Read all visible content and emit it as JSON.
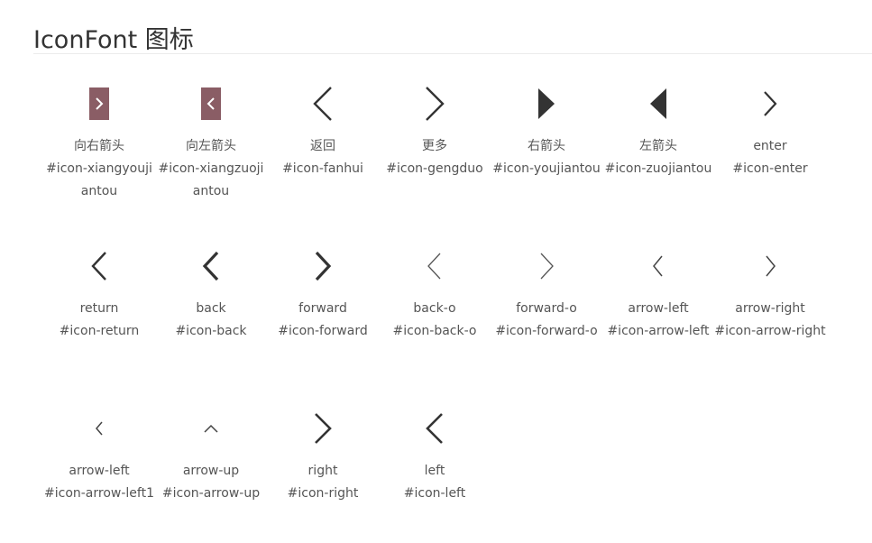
{
  "page": {
    "title": "IconFont 图标"
  },
  "icons": [
    {
      "label": "向右箭头",
      "code": "#icon-xiangyoujiantou",
      "icon": "arrow-right-boxed-icon",
      "color": "#8a5d65"
    },
    {
      "label": "向左箭头",
      "code": "#icon-xiangzuojiantou",
      "icon": "arrow-left-boxed-icon",
      "color": "#8a5d65"
    },
    {
      "label": "返回",
      "code": "#icon-fanhui",
      "icon": "chevron-left-large-icon"
    },
    {
      "label": "更多",
      "code": "#icon-gengduo",
      "icon": "chevron-right-large-icon"
    },
    {
      "label": "右箭头",
      "code": "#icon-youjiantou",
      "icon": "triangle-right-icon"
    },
    {
      "label": "左箭头",
      "code": "#icon-zuojiantou",
      "icon": "triangle-left-icon"
    },
    {
      "label": "enter",
      "code": "#icon-enter",
      "icon": "chevron-right-icon"
    },
    {
      "label": "return",
      "code": "#icon-return",
      "icon": "chevron-left-icon"
    },
    {
      "label": "back",
      "code": "#icon-back",
      "icon": "chevron-left-bold-icon"
    },
    {
      "label": "forward",
      "code": "#icon-forward",
      "icon": "chevron-right-bold-icon"
    },
    {
      "label": "back-o",
      "code": "#icon-back-o",
      "icon": "chevron-left-thin-icon"
    },
    {
      "label": "forward-o",
      "code": "#icon-forward-o",
      "icon": "chevron-right-thin-icon"
    },
    {
      "label": "arrow-left",
      "code": "#icon-arrow-left",
      "icon": "chevron-left-small-icon"
    },
    {
      "label": "arrow-right",
      "code": "#icon-arrow-right",
      "icon": "chevron-right-small-icon"
    },
    {
      "label": "arrow-left",
      "code": "#icon-arrow-left1",
      "icon": "chevron-left-tiny-icon"
    },
    {
      "label": "arrow-up",
      "code": "#icon-arrow-up",
      "icon": "chevron-up-icon"
    },
    {
      "label": "right",
      "code": "#icon-right",
      "icon": "chevron-right-medium-icon"
    },
    {
      "label": "left",
      "code": "#icon-left",
      "icon": "chevron-left-medium-icon"
    }
  ]
}
